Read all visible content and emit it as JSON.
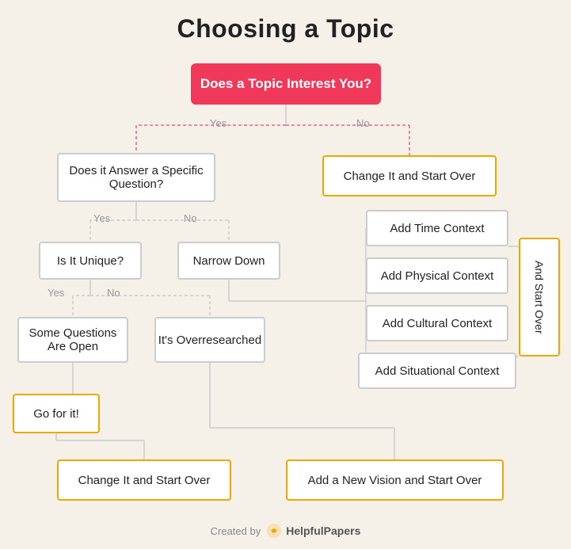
{
  "title": "Choosing a Topic",
  "nodes": {
    "start": "Does a Topic Interest You?",
    "question1": "Does it Answer a Specific Question?",
    "change1": "Change It and Start Over",
    "unique": "Is It Unique?",
    "narrow": "Narrow Down",
    "somequestions": "Some Questions Are Open",
    "overresearched": "It's Overresearched",
    "goit": "Go for it!",
    "change2": "Change It and Start Over",
    "newvision": "Add a New Vision and Start Over",
    "time": "Add Time Context",
    "physical": "Add Physical Context",
    "cultural": "Add Cultural Context",
    "situational": "Add Situational Context",
    "andstartover": "And Start Over"
  },
  "labels": {
    "yes1": "Yes",
    "no1": "No",
    "yes2": "Yes",
    "no2": "No",
    "yes3": "Yes",
    "no3": "No"
  },
  "footer": {
    "created": "Created by",
    "brand": "HelpfulPapers"
  }
}
